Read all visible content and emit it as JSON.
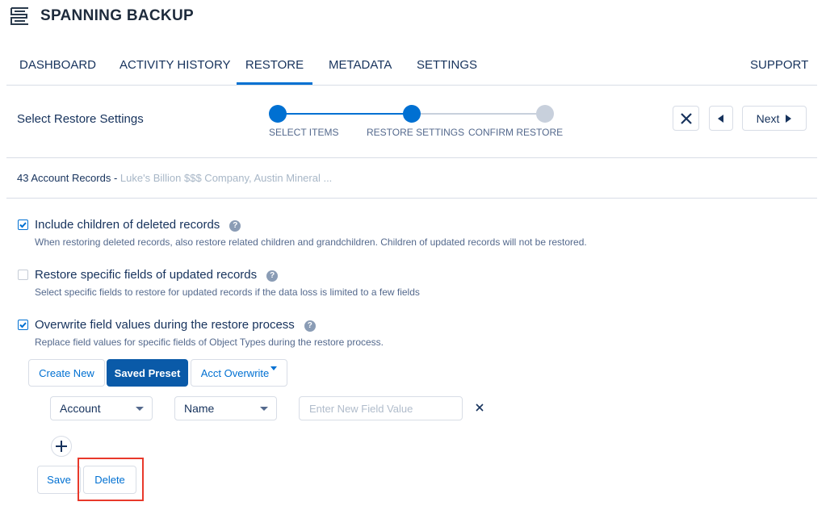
{
  "app": {
    "title": "SPANNING BACKUP",
    "logo_icon": "spanning-logo-icon"
  },
  "nav": {
    "items": [
      {
        "label": "DASHBOARD"
      },
      {
        "label": "ACTIVITY HISTORY"
      },
      {
        "label": "RESTORE"
      },
      {
        "label": "METADATA"
      },
      {
        "label": "SETTINGS"
      }
    ],
    "active": "RESTORE",
    "support_label": "SUPPORT"
  },
  "steps": {
    "title": "Select Restore Settings",
    "items": [
      {
        "label": "SELECT ITEMS",
        "state": "done"
      },
      {
        "label": "RESTORE SETTINGS",
        "state": "current"
      },
      {
        "label": "CONFIRM RESTORE",
        "state": "todo"
      }
    ],
    "close_icon": "close-icon",
    "back_icon": "back-arrow-icon",
    "next_label": "Next",
    "next_icon": "forward-arrow-icon"
  },
  "records": {
    "count_label": "43 Account Records -",
    "names": "Luke's Billion $$$ Company, Austin Mineral ..."
  },
  "options": [
    {
      "title": "Include children of deleted records",
      "description": "When restoring deleted records, also restore related children and grandchildren. Children of updated records will not be restored.",
      "checked": true
    },
    {
      "title": "Restore specific fields of updated records",
      "description": "Select specific fields to restore for updated records if the data loss is limited to a few fields",
      "checked": false
    },
    {
      "title": "Overwrite field values during the restore process",
      "description": "Replace field values for specific fields of Object Types during the restore process.",
      "checked": true
    }
  ],
  "help_glyph": "?",
  "preset_tabs": {
    "create_new": "Create New",
    "saved_preset": "Saved Preset",
    "preset_name": "Acct Overwrite"
  },
  "overwrite_row": {
    "object_value": "Account",
    "field_value": "Name",
    "new_value_placeholder": "Enter New Field Value",
    "remove_icon": "close-icon"
  },
  "add_icon": "plus-icon",
  "actions": {
    "save_label": "Save",
    "delete_label": "Delete"
  },
  "colors": {
    "accent": "#0070d2",
    "brand_button": "#0a5aa8",
    "step_todo": "#c8d0dc",
    "highlight": "#e8392b"
  }
}
